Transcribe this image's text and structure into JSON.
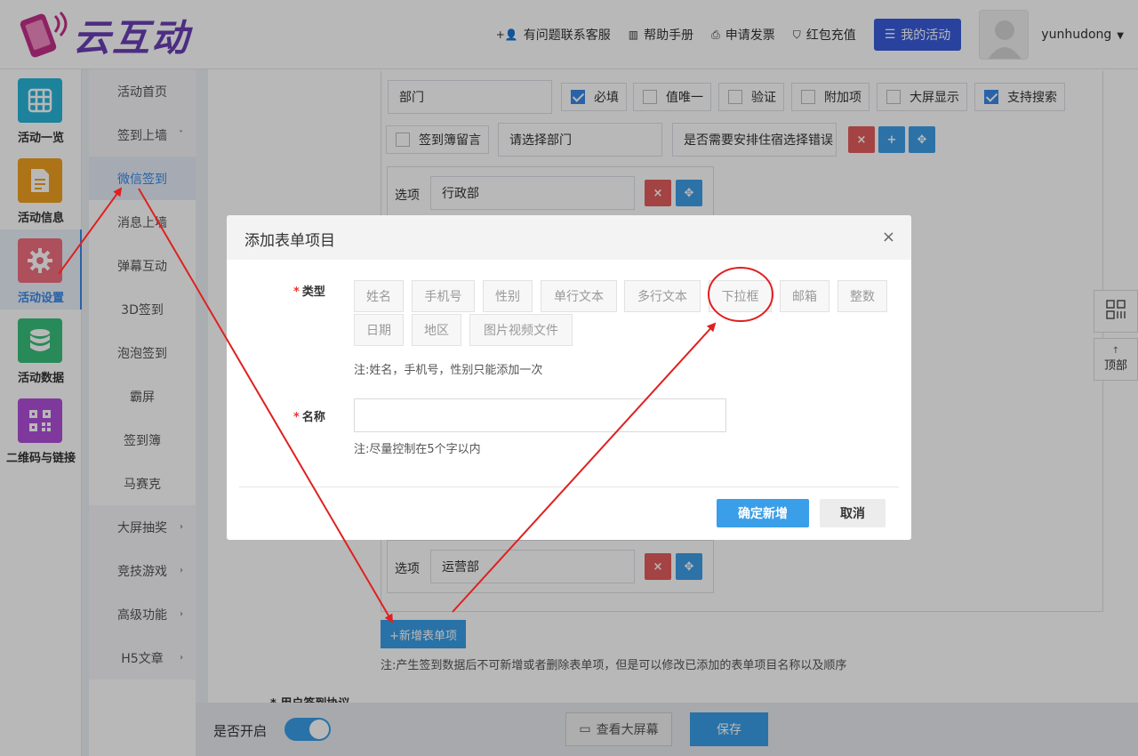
{
  "header": {
    "logo_text": "云互动",
    "nav": [
      {
        "label": "有问题联系客服",
        "icon": "add-user-icon"
      },
      {
        "label": "帮助手册",
        "icon": "book-icon"
      },
      {
        "label": "申请发票",
        "icon": "printer-icon"
      },
      {
        "label": "红包充值",
        "icon": "shield-check-icon"
      }
    ],
    "my_activity_label": "我的活动",
    "username": "yunhudong"
  },
  "icon_sidebar": [
    {
      "label": "活动一览",
      "icon": "grid-icon",
      "color": "#29b4d8"
    },
    {
      "label": "活动信息",
      "icon": "document-icon",
      "color": "#f0a020"
    },
    {
      "label": "活动设置",
      "icon": "gear-icon",
      "color": "#f07080",
      "active": true
    },
    {
      "label": "活动数据",
      "icon": "database-icon",
      "color": "#38c07a"
    },
    {
      "label": "二维码与链接",
      "icon": "qrcode-icon",
      "color": "#b050d8"
    }
  ],
  "menu": {
    "items": [
      {
        "label": "活动首页",
        "arrow": ""
      },
      {
        "label": "签到上墙",
        "arrow": "˅"
      },
      {
        "label": "微信签到",
        "arrow": ""
      },
      {
        "label": "消息上墙",
        "arrow": ""
      },
      {
        "label": "弹幕互动",
        "arrow": ""
      },
      {
        "label": "3D签到",
        "arrow": ""
      },
      {
        "label": "泡泡签到",
        "arrow": ""
      },
      {
        "label": "霸屏",
        "arrow": ""
      },
      {
        "label": "签到簿",
        "arrow": ""
      },
      {
        "label": "马赛克",
        "arrow": ""
      },
      {
        "label": "大屏抽奖",
        "arrow": "›"
      },
      {
        "label": "竞技游戏",
        "arrow": "›"
      },
      {
        "label": "高级功能",
        "arrow": "›"
      },
      {
        "label": "H5文章",
        "arrow": "›"
      }
    ]
  },
  "form": {
    "field_name": "部门",
    "checks": [
      {
        "label": "必填",
        "checked": true
      },
      {
        "label": "值唯一",
        "checked": false
      },
      {
        "label": "验证",
        "checked": false
      },
      {
        "label": "附加项",
        "checked": false
      },
      {
        "label": "大屏显示",
        "checked": false
      },
      {
        "label": "支持搜索",
        "checked": true
      }
    ],
    "guestbook_label": "签到簿留言",
    "select_placeholder": "请选择部门",
    "question_text": "是否需要安排住宿选择错误",
    "option_label": "选项",
    "option_first": "行政部",
    "option_last": "运营部",
    "btn_delete": "×",
    "btn_add": "+",
    "btn_move": "✥"
  },
  "add_item_button": "+新增表单项",
  "add_item_note": "注:产生签到数据后不可新增或者删除表单项，但是可以修改已添加的表单项目名称以及顺序",
  "agreement_label": "* 用户签到协议",
  "bottom_bar": {
    "enable_label": "是否开启",
    "enabled": true,
    "view_screen_label": "查看大屏幕",
    "save_label": "保存"
  },
  "floating": {
    "top_label": "顶部",
    "top_arrow": "↑"
  },
  "modal": {
    "title": "添加表单项目",
    "close": "×",
    "type_label": "类型",
    "type_options": [
      "姓名",
      "手机号",
      "性别",
      "单行文本",
      "多行文本",
      "下拉框",
      "邮箱",
      "整数",
      "日期",
      "地区",
      "图片视频文件"
    ],
    "type_note": "注:姓名，手机号，性别只能添加一次",
    "name_label": "名称",
    "name_value": "",
    "name_note": "注:尽量控制在5个字以内",
    "confirm_label": "确定新增",
    "cancel_label": "取消"
  },
  "annotation_color": "#e02020"
}
